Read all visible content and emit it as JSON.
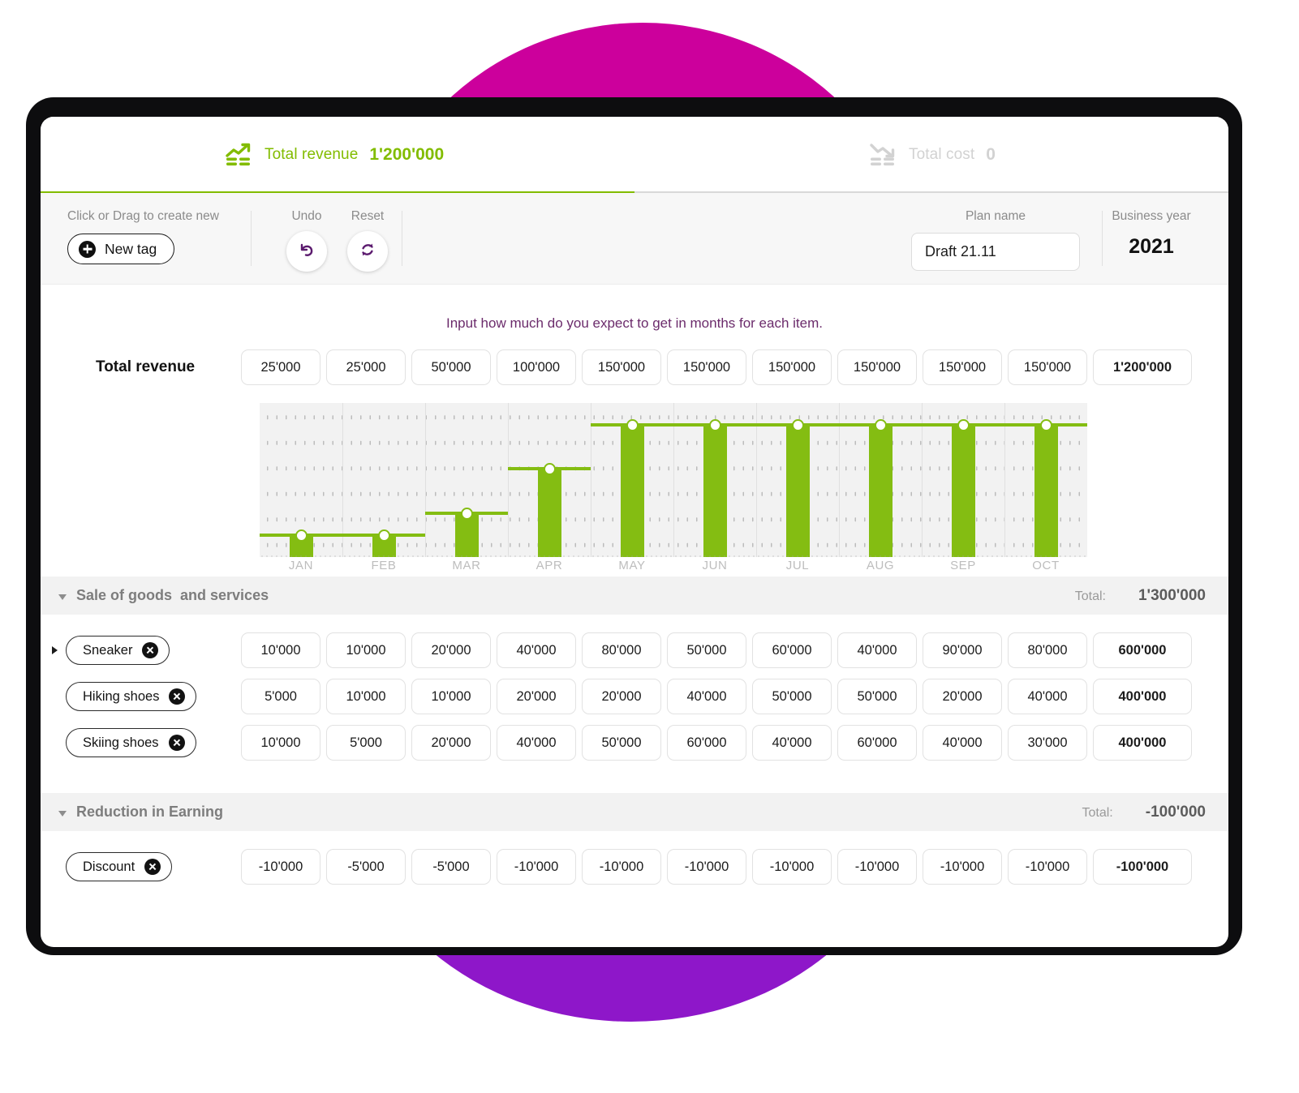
{
  "header": {
    "revenue_label": "Total revenue",
    "revenue_value": "1'200'000",
    "revenue_icon": "chart-up-icon",
    "cost_label": "Total cost",
    "cost_value": "0",
    "cost_icon": "chart-down-icon",
    "accent_green": "#82bc00",
    "muted_grey": "#d2d2d2",
    "progress_percent": 50
  },
  "toolbar": {
    "create_caption": "Click or Drag to create new",
    "new_tag_label": "New tag",
    "undo_caption": "Undo",
    "reset_caption": "Reset",
    "plan_name_caption": "Plan name",
    "plan_name_value": "Draft 21.11",
    "plan_name_placeholder": "Plan name",
    "business_year_caption": "Business year",
    "business_year_value": "2021"
  },
  "instruction": "Input how much do you expect to get in months for each item.",
  "total_revenue_row": {
    "label": "Total revenue",
    "values": [
      "25'000",
      "25'000",
      "50'000",
      "100'000",
      "150'000",
      "150'000",
      "150'000",
      "150'000",
      "150'000",
      "150'000"
    ],
    "total": "1'200'000"
  },
  "chart_data": {
    "type": "bar",
    "title": "Total revenue per month",
    "xlabel": "",
    "ylabel": "",
    "categories": [
      "JAN",
      "FEB",
      "MAR",
      "APR",
      "MAY",
      "JUN",
      "JUL",
      "AUG",
      "SEP",
      "OCT"
    ],
    "values": [
      25000,
      25000,
      50000,
      100000,
      150000,
      150000,
      150000,
      150000,
      150000,
      150000
    ],
    "ylim": [
      0,
      175000
    ],
    "grid": true,
    "legend": "none",
    "series_color": "#84bd12",
    "handle_color": "#ffffff"
  },
  "sections": [
    {
      "title": "Sale of goods  and services",
      "total_label": "Total:",
      "total_value": "1'300'000",
      "expanded": true,
      "rows": [
        {
          "name": "Sneaker",
          "expandable": true,
          "values": [
            "10'000",
            "10'000",
            "20'000",
            "40'000",
            "80'000",
            "50'000",
            "60'000",
            "40'000",
            "90'000",
            "80'000"
          ],
          "total": "600'000"
        },
        {
          "name": "Hiking shoes",
          "expandable": false,
          "values": [
            "5'000",
            "10'000",
            "10'000",
            "20'000",
            "20'000",
            "40'000",
            "50'000",
            "50'000",
            "20'000",
            "40'000"
          ],
          "total": "400'000"
        },
        {
          "name": "Skiing shoes",
          "expandable": false,
          "values": [
            "10'000",
            "5'000",
            "20'000",
            "40'000",
            "50'000",
            "60'000",
            "40'000",
            "60'000",
            "40'000",
            "30'000"
          ],
          "total": "400'000"
        }
      ]
    },
    {
      "title": "Reduction in Earning",
      "total_label": "Total:",
      "total_value": "-100'000",
      "expanded": true,
      "rows": [
        {
          "name": "Discount",
          "expandable": false,
          "values": [
            "-10'000",
            "-5'000",
            "-5'000",
            "-10'000",
            "-10'000",
            "-10'000",
            "-10'000",
            "-10'000",
            "-10'000",
            "-10'000"
          ],
          "total": "-100'000"
        }
      ]
    }
  ]
}
